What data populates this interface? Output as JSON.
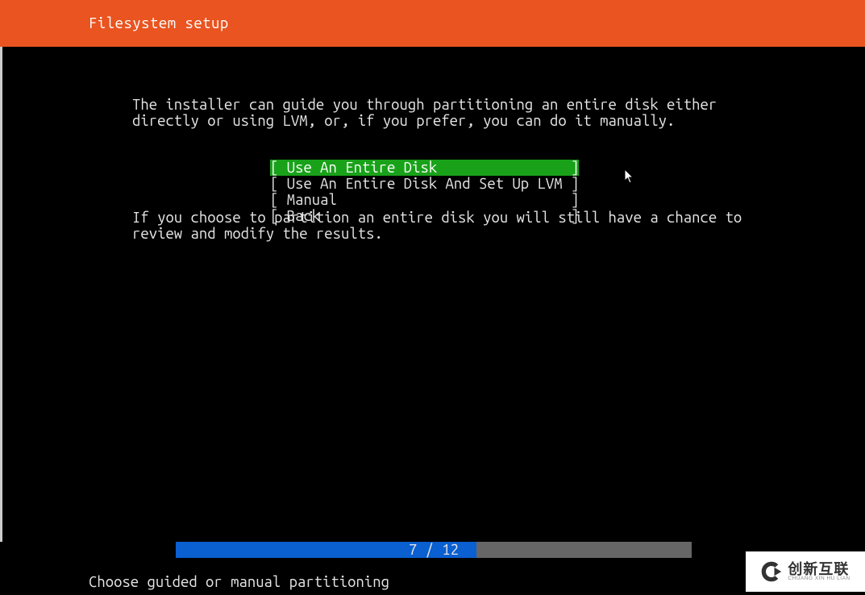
{
  "header": {
    "title": "Filesystem setup"
  },
  "description": {
    "para1": "The installer can guide you through partitioning an entire disk either directly or using LVM, or, if you prefer, you can do it manually.",
    "para2": "If you choose to partition an entire disk you will still have a chance to review and modify the results."
  },
  "menu": {
    "items": [
      {
        "label": "[ Use An Entire Disk                ]",
        "selected": true
      },
      {
        "label": "[ Use An Entire Disk And Set Up LVM ]",
        "selected": false
      },
      {
        "label": "[ Manual                            ]",
        "selected": false
      },
      {
        "label": "[ Back                              ]",
        "selected": false
      }
    ]
  },
  "progress": {
    "current": 7,
    "total": 12,
    "text": "7 / 12",
    "percent": 58.33
  },
  "footer": {
    "hint": "Choose guided or manual partitioning"
  },
  "watermark": {
    "cn": "创新互联",
    "en": "CHUANG XIN HU LIAN"
  }
}
